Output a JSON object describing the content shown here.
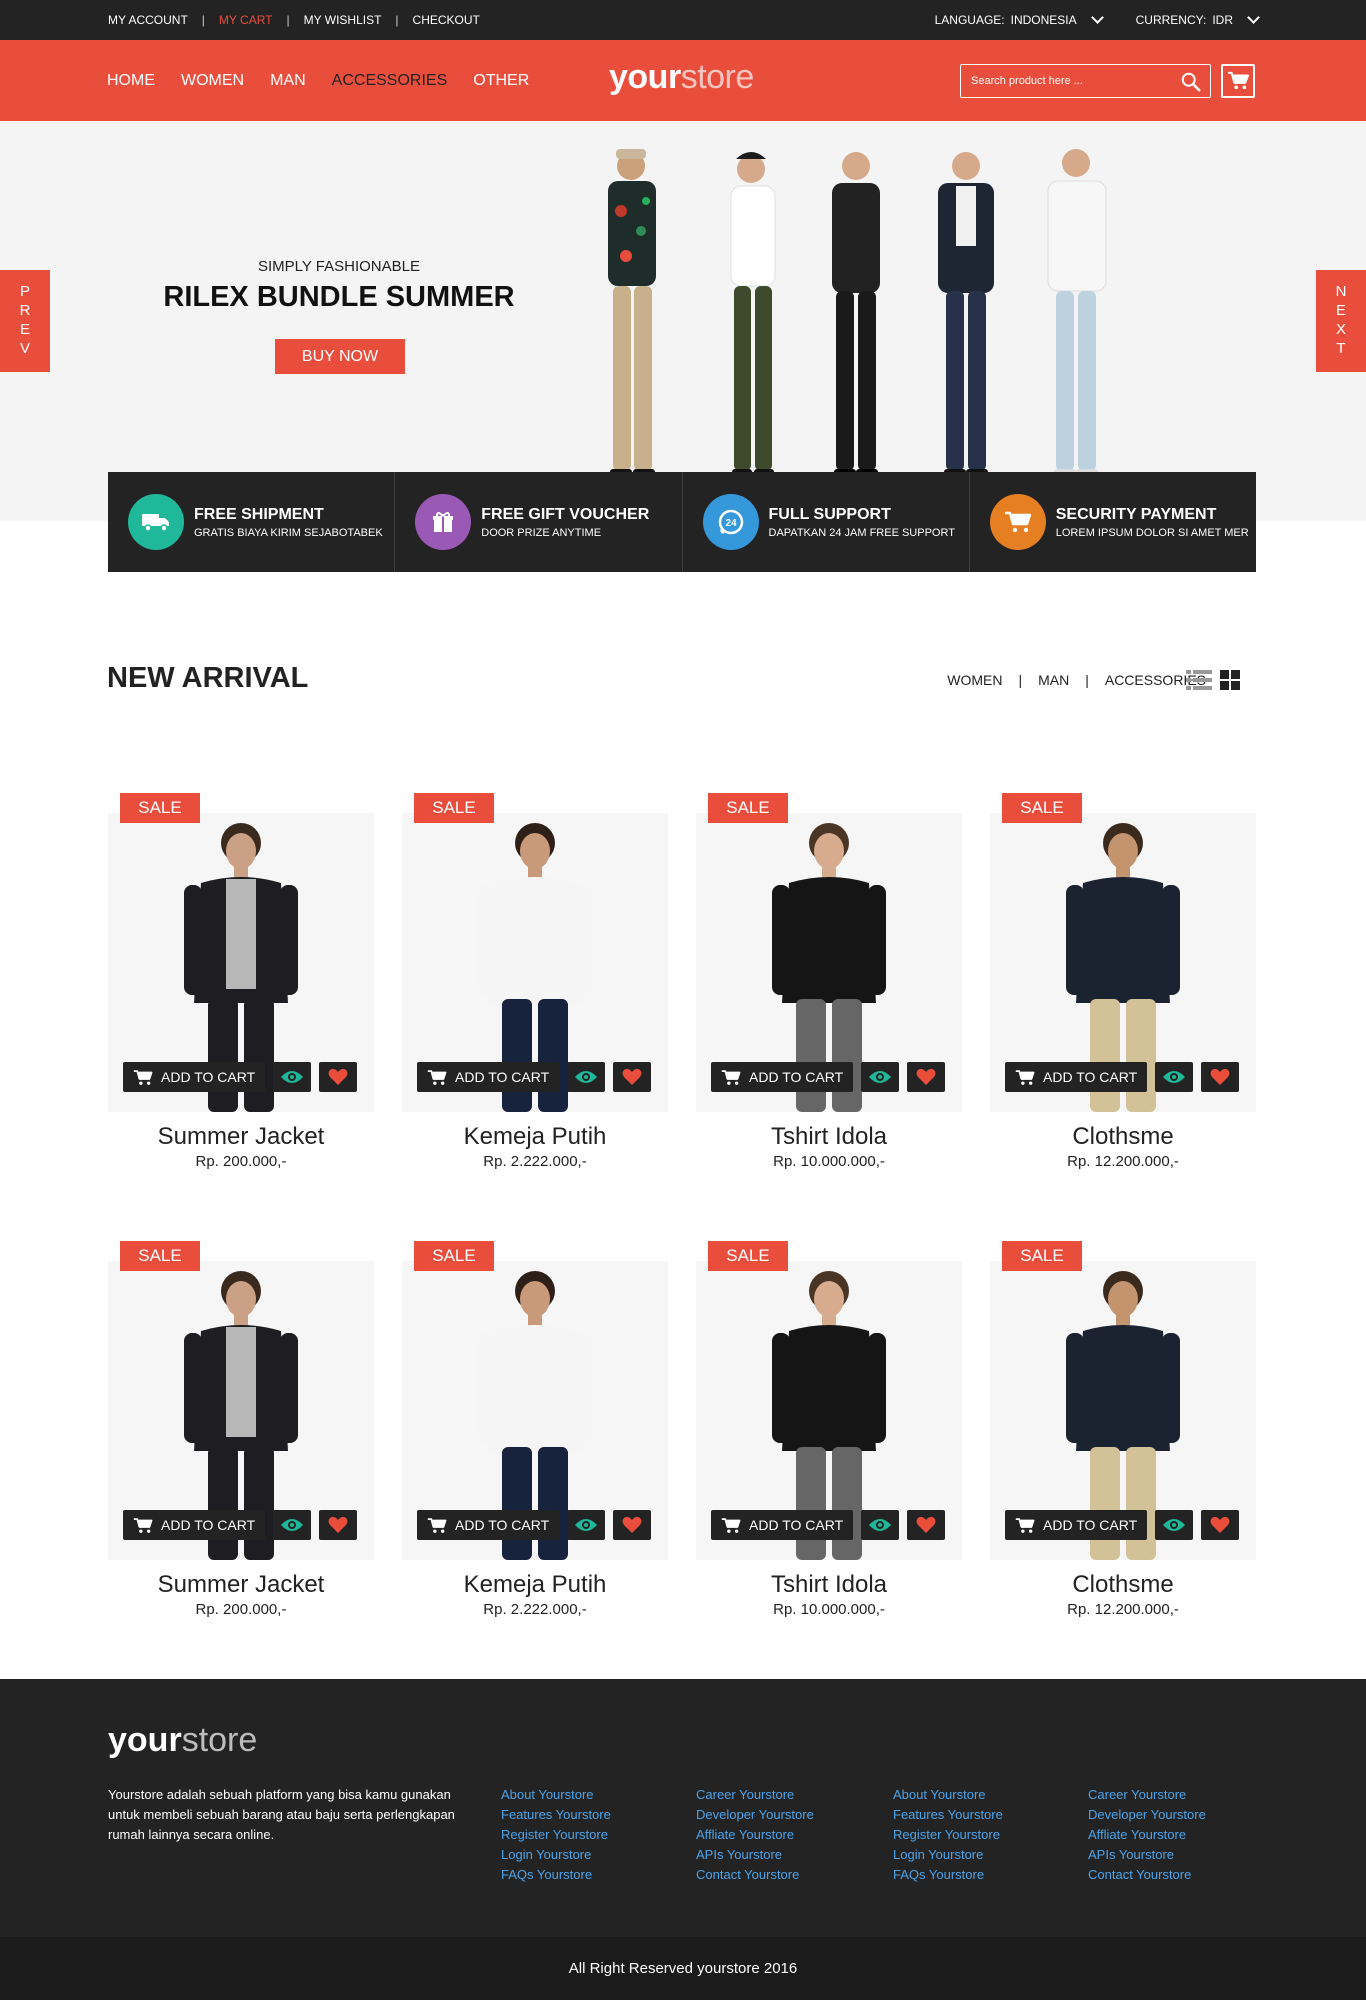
{
  "topbar": {
    "links": [
      "MY ACCOUNT",
      "MY CART",
      "MY WISHLIST",
      "CHECKOUT"
    ],
    "language_label": "LANGUAGE:",
    "language_value": "INDONESIA",
    "currency_label": "CURRENCY:",
    "currency_value": "IDR",
    "accent": "#e94e3d"
  },
  "header": {
    "nav": [
      "HOME",
      "WOMEN",
      "MAN",
      "ACCESSORIES",
      "OTHER"
    ],
    "active_nav": "ACCESSORIES",
    "logo_bold": "your",
    "logo_light": "store",
    "search_placeholder": "Search product here ...",
    "bg": "#e94e3d"
  },
  "hero": {
    "subtitle": "SIMPLY FASHIONABLE",
    "title": "RILEX BUNDLE SUMMER",
    "button": "BUY NOW",
    "prev": "PREV",
    "next": "NEXT"
  },
  "features": [
    {
      "title": "FREE SHIPMENT",
      "subtitle": "GRATIS BIAYA KIRIM SEJABOTABEK",
      "color": "#1fb89a",
      "icon": "truck-icon"
    },
    {
      "title": "FREE GIFT VOUCHER",
      "subtitle": "DOOR PRIZE ANYTIME",
      "color": "#9b59b6",
      "icon": "gift-icon"
    },
    {
      "title": "FULL SUPPORT",
      "subtitle": "DAPATKAN 24 JAM FREE SUPPORT",
      "color": "#3498db",
      "icon": "support-24-icon"
    },
    {
      "title": "SECURITY PAYMENT",
      "subtitle": "LOREM IPSUM DOLOR SI AMET MER",
      "color": "#e67e22",
      "icon": "cart-icon"
    }
  ],
  "new_arrival": {
    "title": "NEW ARRIVAL",
    "filters": [
      "WOMEN",
      "MAN",
      "ACCESSORIES"
    ]
  },
  "products": [
    {
      "name": "Summer Jacket",
      "price": "Rp. 200.000,-",
      "badge": "SALE",
      "add_to_cart": "ADD TO CART"
    },
    {
      "name": "Kemeja Putih",
      "price": "Rp. 2.222.000,-",
      "badge": "SALE",
      "add_to_cart": "ADD TO CART"
    },
    {
      "name": "Tshirt Idola",
      "price": "Rp. 10.000.000,-",
      "badge": "SALE",
      "add_to_cart": "ADD TO CART"
    },
    {
      "name": "Clothsme",
      "price": "Rp. 12.200.000,-",
      "badge": "SALE",
      "add_to_cart": "ADD TO CART"
    },
    {
      "name": "Summer Jacket",
      "price": "Rp. 200.000,-",
      "badge": "SALE",
      "add_to_cart": "ADD TO CART"
    },
    {
      "name": "Kemeja Putih",
      "price": "Rp. 2.222.000,-",
      "badge": "SALE",
      "add_to_cart": "ADD TO CART"
    },
    {
      "name": "Tshirt Idola",
      "price": "Rp. 10.000.000,-",
      "badge": "SALE",
      "add_to_cart": "ADD TO CART"
    },
    {
      "name": "Clothsme",
      "price": "Rp. 12.200.000,-",
      "badge": "SALE",
      "add_to_cart": "ADD TO CART"
    }
  ],
  "footer": {
    "logo_bold": "your",
    "logo_light": "store",
    "description": "Yourstore adalah sebuah platform yang bisa kamu gunakan untuk membeli sebuah barang atau baju serta perlengkapan rumah lainnya secara online.",
    "columns": [
      [
        "About Yourstore",
        "Features Yourstore",
        "Register Yourstore",
        "Login Yourstore",
        "FAQs Yourstore"
      ],
      [
        "Career Yourstore",
        "Developer Yourstore",
        "Affliate Yourstore",
        "APIs Yourstore",
        "Contact Yourstore"
      ],
      [
        "About Yourstore",
        "Features Yourstore",
        "Register Yourstore",
        "Login Yourstore",
        "FAQs Yourstore"
      ],
      [
        "Career Yourstore",
        "Developer Yourstore",
        "Affliate Yourstore",
        "APIs Yourstore",
        "Contact Yourstore"
      ]
    ],
    "copyright": "All Right Reserved yourstore 2016",
    "link_color": "#4aa3ea"
  }
}
